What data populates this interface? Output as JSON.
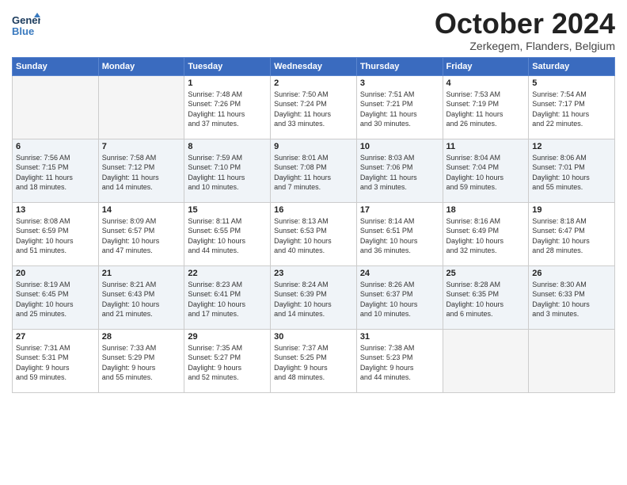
{
  "header": {
    "logo_line1": "General",
    "logo_line2": "Blue",
    "title": "October 2024",
    "subtitle": "Zerkegem, Flanders, Belgium"
  },
  "days_of_week": [
    "Sunday",
    "Monday",
    "Tuesday",
    "Wednesday",
    "Thursday",
    "Friday",
    "Saturday"
  ],
  "weeks": [
    [
      {
        "day": "",
        "info": ""
      },
      {
        "day": "",
        "info": ""
      },
      {
        "day": "1",
        "info": "Sunrise: 7:48 AM\nSunset: 7:26 PM\nDaylight: 11 hours\nand 37 minutes."
      },
      {
        "day": "2",
        "info": "Sunrise: 7:50 AM\nSunset: 7:24 PM\nDaylight: 11 hours\nand 33 minutes."
      },
      {
        "day": "3",
        "info": "Sunrise: 7:51 AM\nSunset: 7:21 PM\nDaylight: 11 hours\nand 30 minutes."
      },
      {
        "day": "4",
        "info": "Sunrise: 7:53 AM\nSunset: 7:19 PM\nDaylight: 11 hours\nand 26 minutes."
      },
      {
        "day": "5",
        "info": "Sunrise: 7:54 AM\nSunset: 7:17 PM\nDaylight: 11 hours\nand 22 minutes."
      }
    ],
    [
      {
        "day": "6",
        "info": "Sunrise: 7:56 AM\nSunset: 7:15 PM\nDaylight: 11 hours\nand 18 minutes."
      },
      {
        "day": "7",
        "info": "Sunrise: 7:58 AM\nSunset: 7:12 PM\nDaylight: 11 hours\nand 14 minutes."
      },
      {
        "day": "8",
        "info": "Sunrise: 7:59 AM\nSunset: 7:10 PM\nDaylight: 11 hours\nand 10 minutes."
      },
      {
        "day": "9",
        "info": "Sunrise: 8:01 AM\nSunset: 7:08 PM\nDaylight: 11 hours\nand 7 minutes."
      },
      {
        "day": "10",
        "info": "Sunrise: 8:03 AM\nSunset: 7:06 PM\nDaylight: 11 hours\nand 3 minutes."
      },
      {
        "day": "11",
        "info": "Sunrise: 8:04 AM\nSunset: 7:04 PM\nDaylight: 10 hours\nand 59 minutes."
      },
      {
        "day": "12",
        "info": "Sunrise: 8:06 AM\nSunset: 7:01 PM\nDaylight: 10 hours\nand 55 minutes."
      }
    ],
    [
      {
        "day": "13",
        "info": "Sunrise: 8:08 AM\nSunset: 6:59 PM\nDaylight: 10 hours\nand 51 minutes."
      },
      {
        "day": "14",
        "info": "Sunrise: 8:09 AM\nSunset: 6:57 PM\nDaylight: 10 hours\nand 47 minutes."
      },
      {
        "day": "15",
        "info": "Sunrise: 8:11 AM\nSunset: 6:55 PM\nDaylight: 10 hours\nand 44 minutes."
      },
      {
        "day": "16",
        "info": "Sunrise: 8:13 AM\nSunset: 6:53 PM\nDaylight: 10 hours\nand 40 minutes."
      },
      {
        "day": "17",
        "info": "Sunrise: 8:14 AM\nSunset: 6:51 PM\nDaylight: 10 hours\nand 36 minutes."
      },
      {
        "day": "18",
        "info": "Sunrise: 8:16 AM\nSunset: 6:49 PM\nDaylight: 10 hours\nand 32 minutes."
      },
      {
        "day": "19",
        "info": "Sunrise: 8:18 AM\nSunset: 6:47 PM\nDaylight: 10 hours\nand 28 minutes."
      }
    ],
    [
      {
        "day": "20",
        "info": "Sunrise: 8:19 AM\nSunset: 6:45 PM\nDaylight: 10 hours\nand 25 minutes."
      },
      {
        "day": "21",
        "info": "Sunrise: 8:21 AM\nSunset: 6:43 PM\nDaylight: 10 hours\nand 21 minutes."
      },
      {
        "day": "22",
        "info": "Sunrise: 8:23 AM\nSunset: 6:41 PM\nDaylight: 10 hours\nand 17 minutes."
      },
      {
        "day": "23",
        "info": "Sunrise: 8:24 AM\nSunset: 6:39 PM\nDaylight: 10 hours\nand 14 minutes."
      },
      {
        "day": "24",
        "info": "Sunrise: 8:26 AM\nSunset: 6:37 PM\nDaylight: 10 hours\nand 10 minutes."
      },
      {
        "day": "25",
        "info": "Sunrise: 8:28 AM\nSunset: 6:35 PM\nDaylight: 10 hours\nand 6 minutes."
      },
      {
        "day": "26",
        "info": "Sunrise: 8:30 AM\nSunset: 6:33 PM\nDaylight: 10 hours\nand 3 minutes."
      }
    ],
    [
      {
        "day": "27",
        "info": "Sunrise: 7:31 AM\nSunset: 5:31 PM\nDaylight: 9 hours\nand 59 minutes."
      },
      {
        "day": "28",
        "info": "Sunrise: 7:33 AM\nSunset: 5:29 PM\nDaylight: 9 hours\nand 55 minutes."
      },
      {
        "day": "29",
        "info": "Sunrise: 7:35 AM\nSunset: 5:27 PM\nDaylight: 9 hours\nand 52 minutes."
      },
      {
        "day": "30",
        "info": "Sunrise: 7:37 AM\nSunset: 5:25 PM\nDaylight: 9 hours\nand 48 minutes."
      },
      {
        "day": "31",
        "info": "Sunrise: 7:38 AM\nSunset: 5:23 PM\nDaylight: 9 hours\nand 44 minutes."
      },
      {
        "day": "",
        "info": ""
      },
      {
        "day": "",
        "info": ""
      }
    ]
  ]
}
